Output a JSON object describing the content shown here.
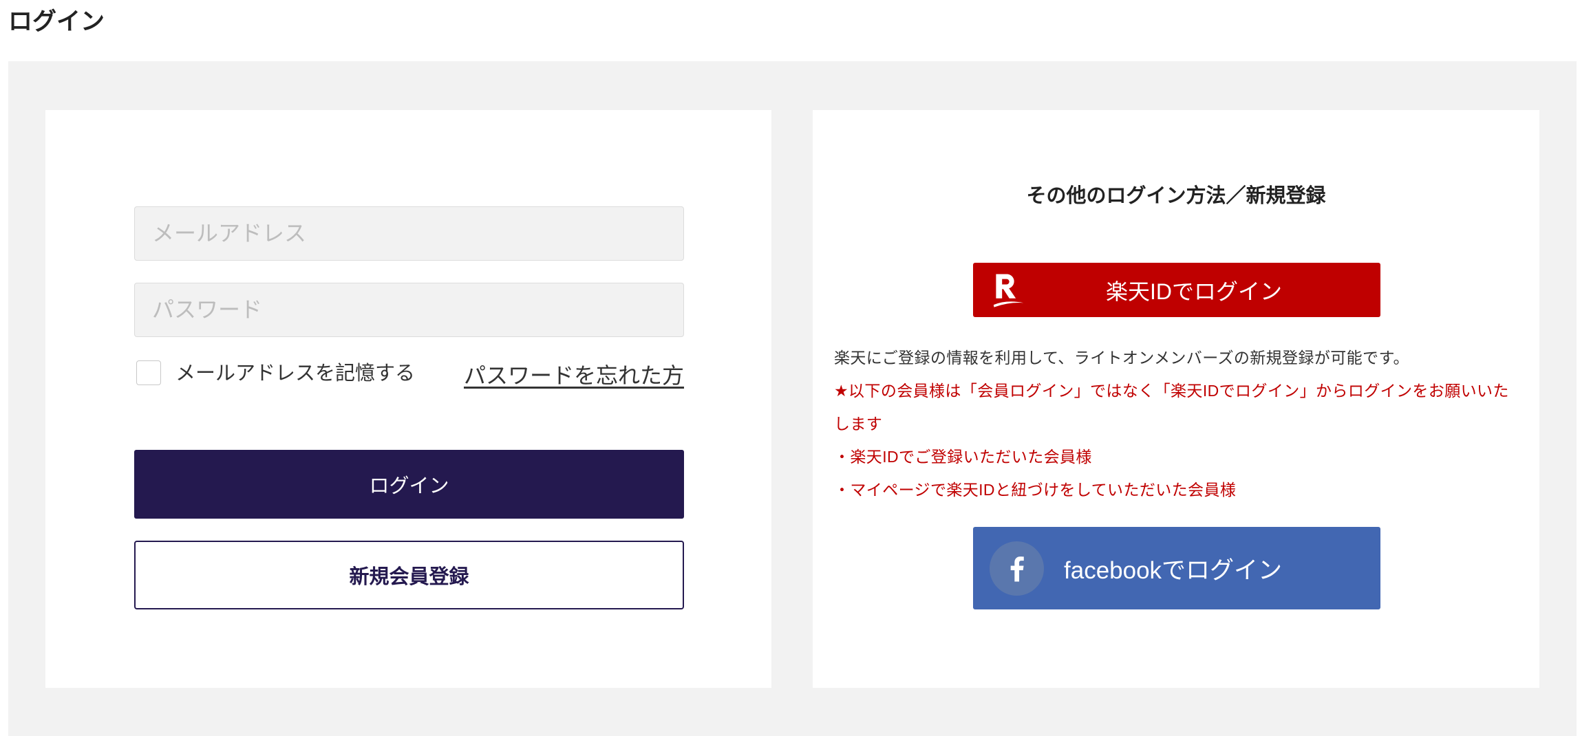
{
  "page": {
    "title": "ログイン"
  },
  "login_form": {
    "email": {
      "placeholder": "メールアドレス",
      "value": ""
    },
    "password": {
      "placeholder": "パスワード",
      "value": ""
    },
    "remember": {
      "label": "メールアドレスを記憶する",
      "checked": false
    },
    "forgot_password_label": "パスワードを忘れた方",
    "login_button_label": "ログイン",
    "register_button_label": "新規会員登録"
  },
  "other_login": {
    "title": "その他のログイン方法／新規登録",
    "rakuten_button_label": "楽天IDでログイン",
    "description": "楽天にご登録の情報を利用して、ライトオンメンバーズの新規登録が可能です。",
    "notice_lines": [
      "★以下の会員様は「会員ログイン」ではなく「楽天IDでログイン」からログインをお願いいたします",
      "・楽天IDでご登録いただいた会員様",
      "・マイページで楽天IDと紐づけをしていただいた会員様"
    ],
    "facebook_button_label": "facebookでログイン"
  },
  "icons": {
    "rakuten": "rakuten-r-logo-icon",
    "facebook": "facebook-f-icon",
    "checkbox": "checkbox-unchecked"
  },
  "colors": {
    "background_gray": "#f2f2f2",
    "primary_navy": "#24194f",
    "rakuten_red": "#bf0000",
    "facebook_blue": "#4267b2",
    "notice_red": "#c00000"
  }
}
